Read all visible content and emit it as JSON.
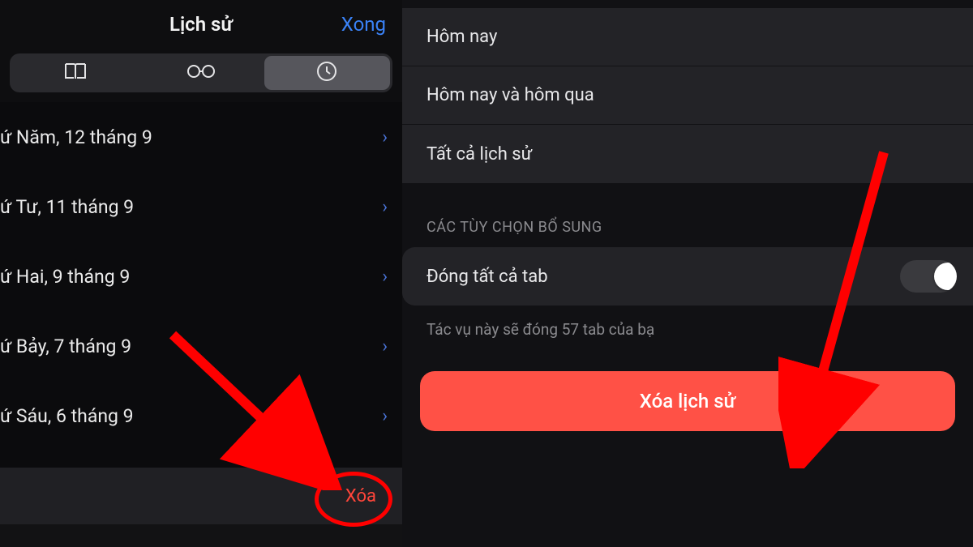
{
  "left": {
    "title": "Lịch sử",
    "done": "Xong",
    "items": [
      "ứ Năm, 12 tháng 9",
      "ứ Tư, 11 tháng 9",
      "ứ Hai, 9 tháng 9",
      "ứ Bảy, 7 tháng 9",
      "ứ Sáu, 6 tháng 9"
    ],
    "clear": "Xóa"
  },
  "right": {
    "options": [
      "Hôm nay",
      "Hôm nay và hôm qua",
      "Tất cả lịch sử"
    ],
    "section_label": "CÁC TÙY CHỌN BỔ SUNG",
    "toggle_label": "Đóng tất cả tab",
    "hint": "Tác vụ này sẽ đóng 57 tab của bạ",
    "destructive": "Xóa lịch sử"
  }
}
